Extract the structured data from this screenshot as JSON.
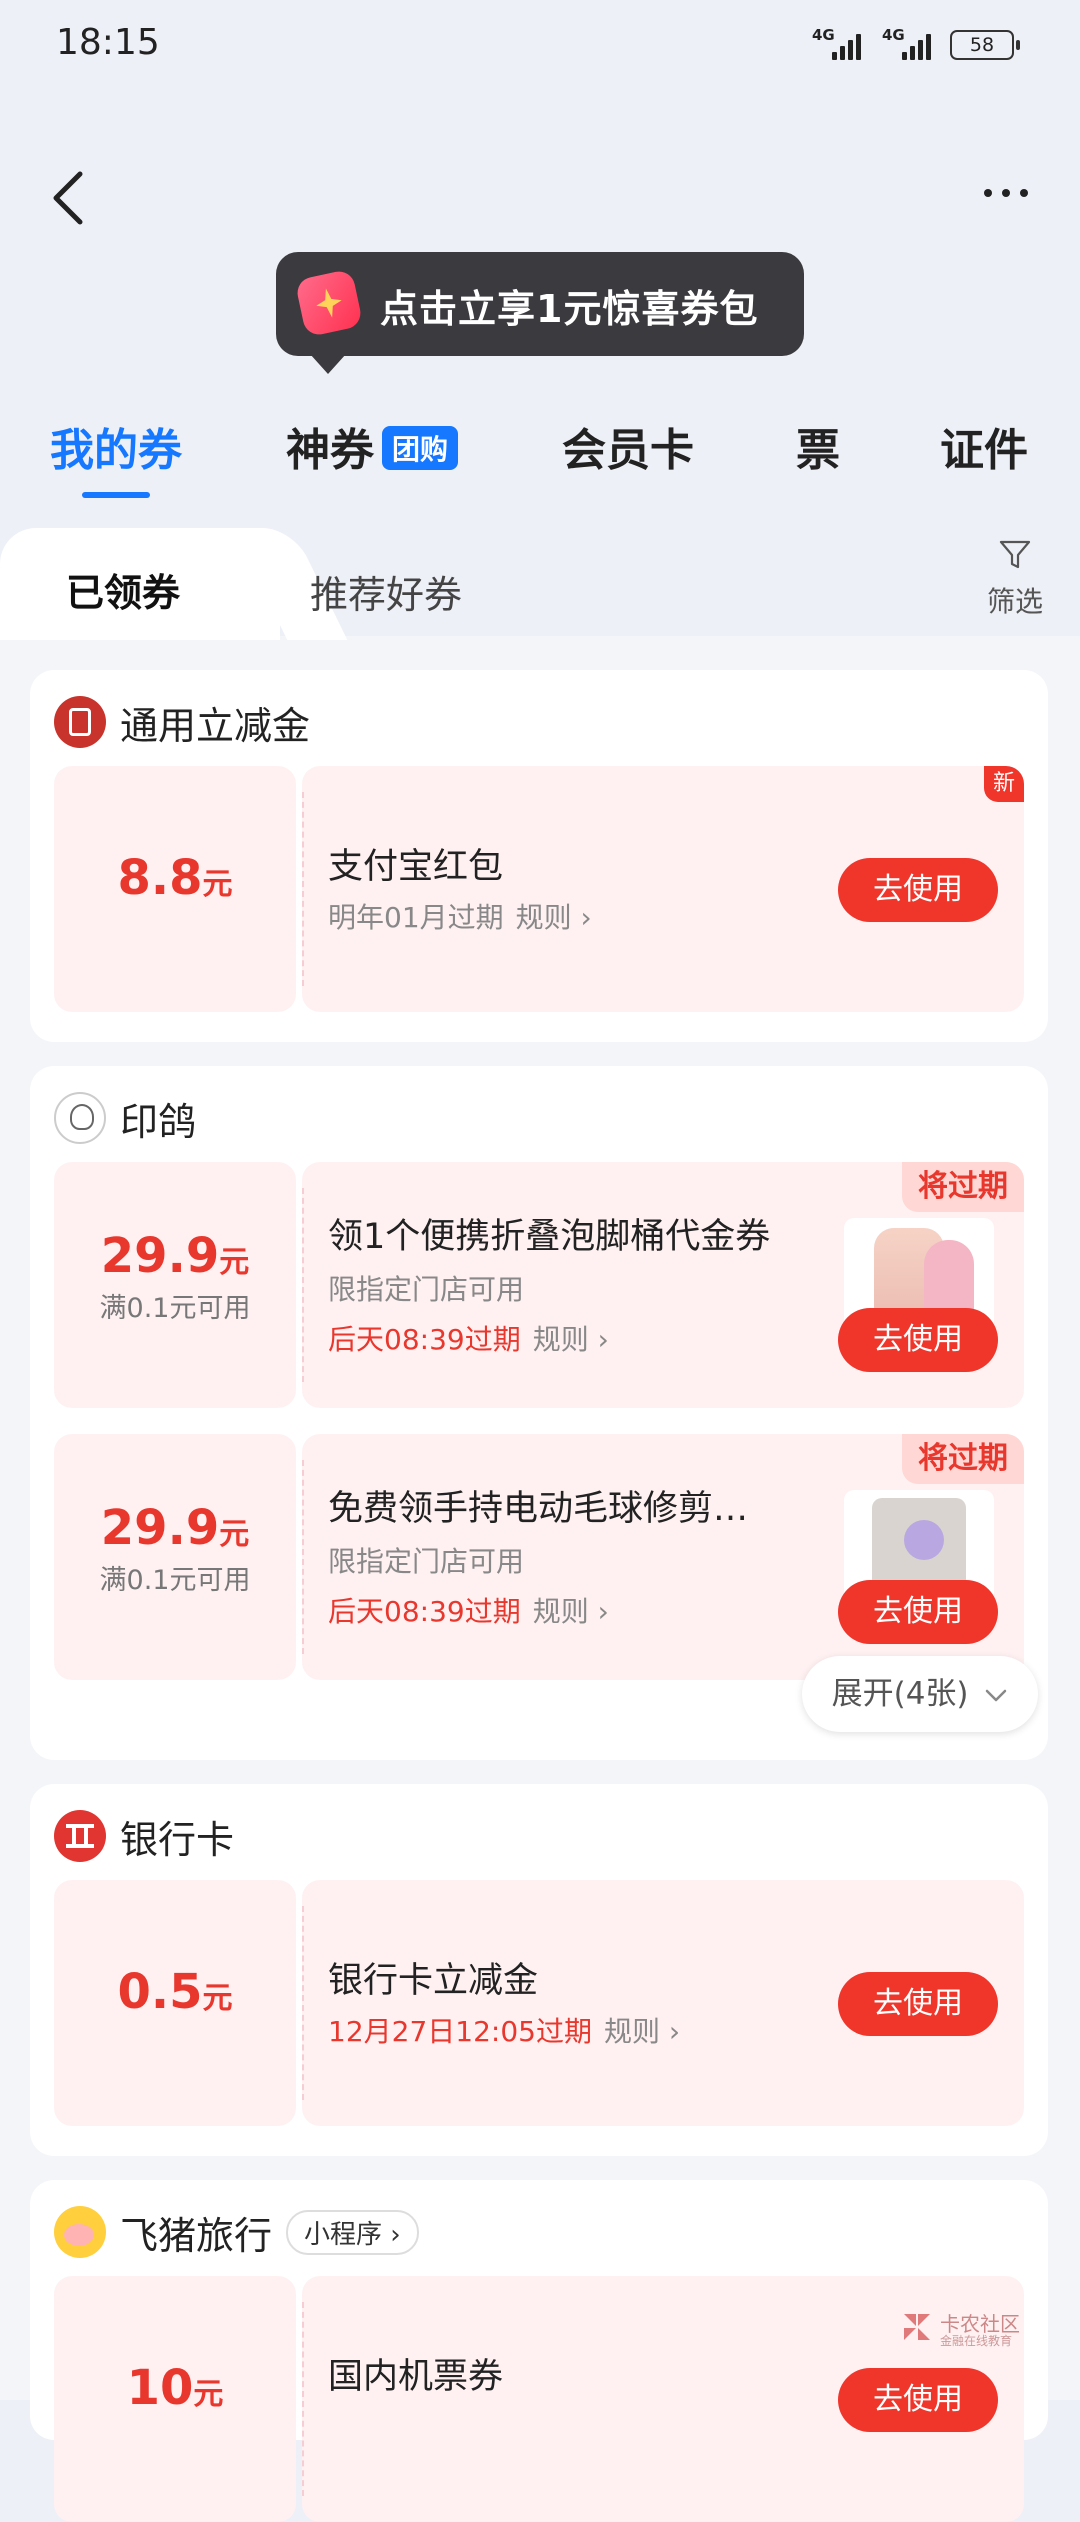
{
  "status_bar": {
    "time": "18:15",
    "net1": "4G",
    "net2": "4G",
    "battery": "58"
  },
  "tooltip": {
    "text": "点击立享1元惊喜券包"
  },
  "tabs": [
    {
      "label": "我的券"
    },
    {
      "label": "神券",
      "badge": "团购"
    },
    {
      "label": "会员卡"
    },
    {
      "label": "票"
    },
    {
      "label": "证件"
    }
  ],
  "subtabs": {
    "claimed": "已领券",
    "recommended": "推荐好券",
    "filter": "筛选"
  },
  "sections": [
    {
      "title": "通用立减金",
      "coupons": [
        {
          "amount": "8.8",
          "unit": "元",
          "title": "支付宝红包",
          "expire": "明年01月过期",
          "rule": "规则",
          "button": "去使用",
          "tag": "新"
        }
      ]
    },
    {
      "title": "印鸽",
      "coupons": [
        {
          "amount": "29.9",
          "unit": "元",
          "condition": "满0.1元可用",
          "title": "领1个便携折叠泡脚桶代金券",
          "subtitle": "限指定门店可用",
          "expire": "后天08:39过期",
          "rule": "规则",
          "button": "去使用",
          "tag": "将过期"
        },
        {
          "amount": "29.9",
          "unit": "元",
          "condition": "满0.1元可用",
          "title": "免费领手持电动毛球修剪…",
          "subtitle": "限指定门店可用",
          "expire": "后天08:39过期",
          "rule": "规则",
          "button": "去使用",
          "tag": "将过期"
        }
      ],
      "expand": "展开(4张)"
    },
    {
      "title": "银行卡",
      "coupons": [
        {
          "amount": "0.5",
          "unit": "元",
          "title": "银行卡立减金",
          "expire": "12月27日12:05过期",
          "rule": "规则",
          "button": "去使用"
        }
      ]
    },
    {
      "title": "飞猪旅行",
      "badge": "小程序",
      "coupons": [
        {
          "amount": "10",
          "unit": "元",
          "title": "国内机票券",
          "button": "去使用"
        }
      ]
    }
  ],
  "watermark": {
    "line1": "卡农社区",
    "line2": "金融在线教育"
  },
  "colors": {
    "accent": "#1677ff",
    "red": "#f0352b",
    "coupon_bg": "#fff1f2"
  }
}
